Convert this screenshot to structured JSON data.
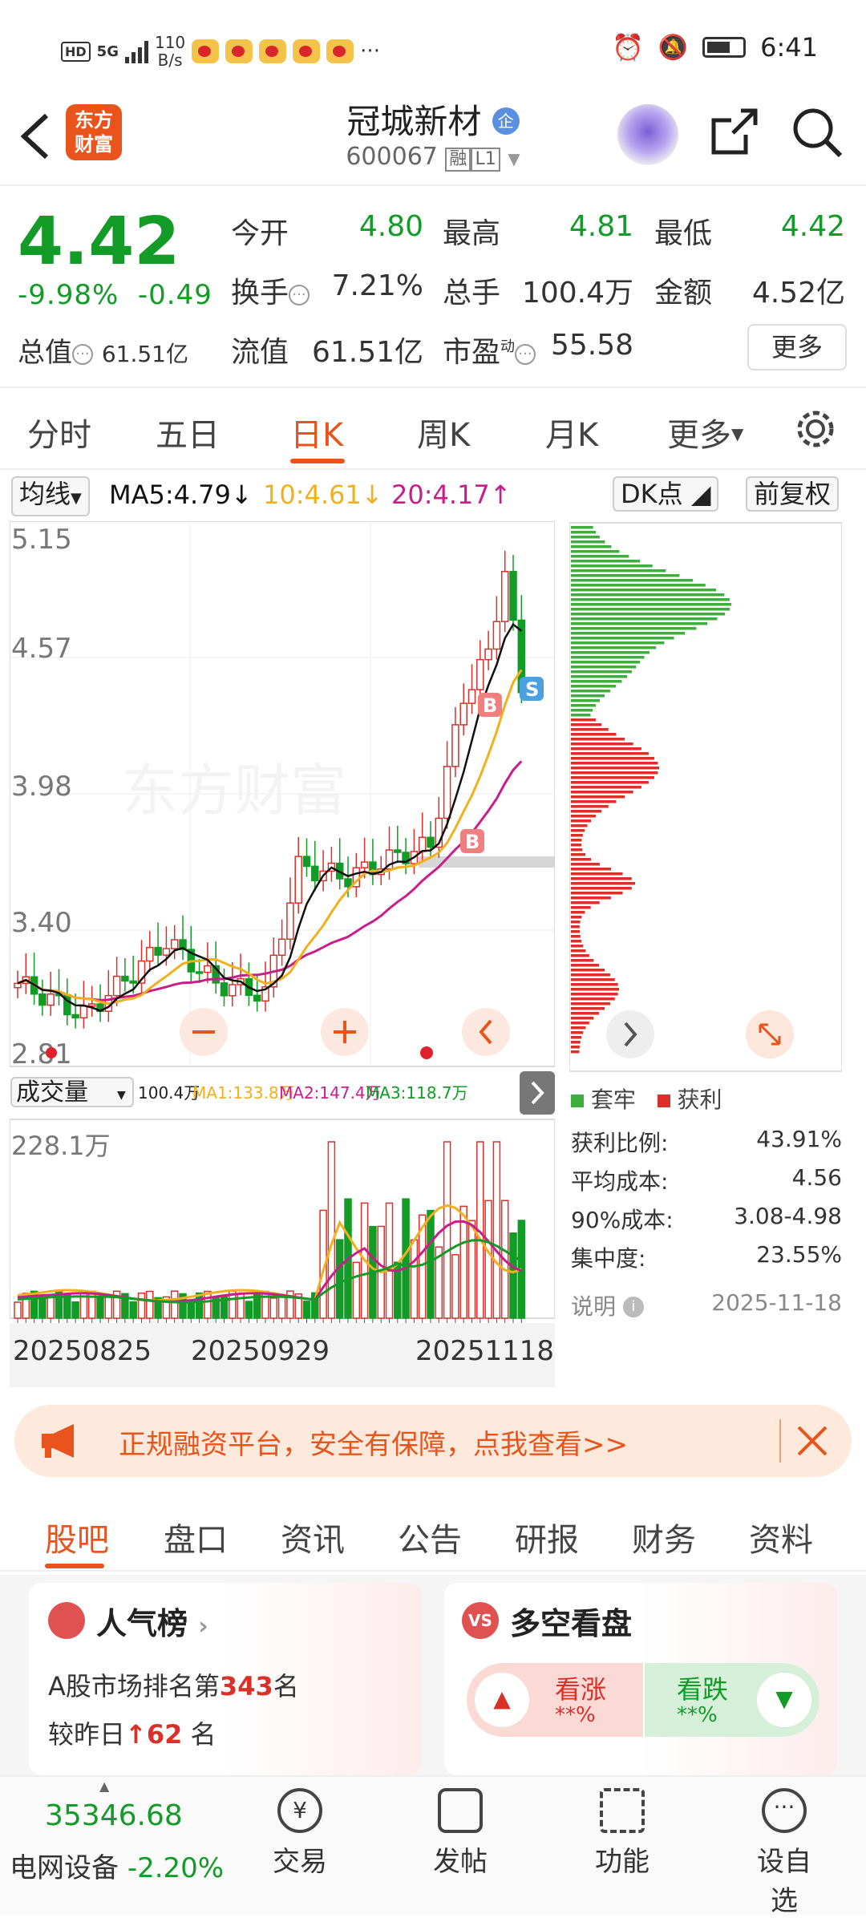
{
  "status_bar": {
    "hd": "HD",
    "net": "5G",
    "speed_top": "110",
    "speed_bottom": "B/s",
    "more": "···",
    "time": "6:41"
  },
  "nav": {
    "logo_line1": "东方",
    "logo_line2": "财富",
    "stock_name": "冠城新材",
    "company_badge": "企",
    "stock_code": "600067",
    "tag_rong": "融",
    "tag_level": "L1"
  },
  "quote": {
    "price": "4.42",
    "change_pct": "-9.98%",
    "change_amt": "-0.49",
    "open_label": "今开",
    "open": "4.80",
    "high_label": "最高",
    "high": "4.81",
    "low_label": "最低",
    "low": "4.42",
    "turnover_label": "换手",
    "turnover": "7.21%",
    "volume_label": "总手",
    "volume": "100.4万",
    "amount_label": "金额",
    "amount": "4.52亿",
    "mktcap_label": "总值",
    "mktcap": "61.51亿",
    "float_label": "流值",
    "float": "61.51亿",
    "pe_label": "市盈",
    "pe_sup": "动",
    "pe": "55.58",
    "more": "更多"
  },
  "period_tabs": [
    "分时",
    "五日",
    "日K",
    "周K",
    "月K",
    "更多"
  ],
  "ma_row": {
    "selector": "均线",
    "ma5": "MA5:4.79",
    "ma10": "10:4.61",
    "ma20": "20:4.17",
    "dk": "DK点",
    "fq": "前复权"
  },
  "price_axis": [
    "5.15",
    "4.57",
    "3.98",
    "3.40",
    "2.81"
  ],
  "watermark": "东方财富",
  "volume_row": {
    "selector": "成交量",
    "v": "100.4万",
    "ma1": "MA1:133.8万",
    "ma2": "MA2:147.4万",
    "ma3": "MA3:118.7万",
    "max": "228.1万"
  },
  "dates": [
    "20250825",
    "20250929",
    "20251118"
  ],
  "chip": {
    "legend_loss": "套牢",
    "legend_profit": "获利",
    "rows": [
      {
        "k": "获利比例:",
        "v": "43.91%"
      },
      {
        "k": "平均成本:",
        "v": "4.56"
      },
      {
        "k": "90%成本:",
        "v": "3.08-4.98"
      },
      {
        "k": "集中度:",
        "v": "23.55%"
      }
    ],
    "note": "说明",
    "date": "2025-11-18"
  },
  "banner": {
    "text": "正规融资平台，安全有保障，点我查看>>"
  },
  "news_tabs": [
    "股吧",
    "盘口",
    "资讯",
    "公告",
    "研报",
    "财务",
    "资料"
  ],
  "cards": {
    "rank_title": "人气榜",
    "rank_line1_pre": "A股市场排名第",
    "rank_num": "343",
    "rank_line1_post": "名",
    "rank_line2_pre": "较昨日",
    "rank_change": "62",
    "rank_line2_post": "名",
    "vs_title": "多空看盘",
    "up_label": "看涨",
    "up_val": "**%",
    "down_label": "看跌",
    "down_val": "**%"
  },
  "bottom": {
    "index_value": "35346.68",
    "sector": "电网设备",
    "sector_chg": "-2.20%",
    "items": [
      "交易",
      "发帖",
      "功能",
      "设自选"
    ]
  },
  "colors": {
    "up": "#d9302a",
    "down": "#129b27",
    "accent": "#e8541c",
    "ma5": "#111111",
    "ma10": "#f2b01e",
    "ma20": "#c81e8c"
  }
}
